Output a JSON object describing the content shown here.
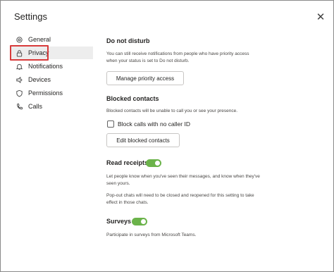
{
  "window": {
    "title": "Settings",
    "close_icon": "close-icon"
  },
  "sidebar": {
    "items": [
      {
        "label": "General",
        "icon": "gear-icon"
      },
      {
        "label": "Privacy",
        "icon": "lock-icon",
        "active": true
      },
      {
        "label": "Notifications",
        "icon": "bell-icon"
      },
      {
        "label": "Devices",
        "icon": "speaker-icon"
      },
      {
        "label": "Permissions",
        "icon": "shield-icon"
      },
      {
        "label": "Calls",
        "icon": "phone-icon"
      }
    ]
  },
  "dnd": {
    "title": "Do not disturb",
    "desc_line1": "You can still receive notifications from people who have priority access",
    "desc_line2": "when your status is set to Do not disturb.",
    "button": "Manage priority access"
  },
  "blocked": {
    "title": "Blocked contacts",
    "desc": "Blocked contacts will be unable to call you or see your presence.",
    "checkbox_label": "Block calls with no caller ID",
    "checkbox_checked": false,
    "button": "Edit blocked contacts"
  },
  "read_receipts": {
    "title": "Read receipts",
    "enabled": true,
    "desc_line1": "Let people know when you've seen their messages, and know when they've",
    "desc_line2": "seen yours.",
    "note_line1": "Pop-out chats will need to be closed and reopened for this setting to take",
    "note_line2": "effect in those chats."
  },
  "surveys": {
    "title": "Surveys",
    "enabled": true,
    "desc": "Participate in surveys from Microsoft Teams."
  },
  "colors": {
    "toggle_on": "#6bb34a",
    "highlight_border": "#d83b3b",
    "active_bg": "#ededed"
  }
}
